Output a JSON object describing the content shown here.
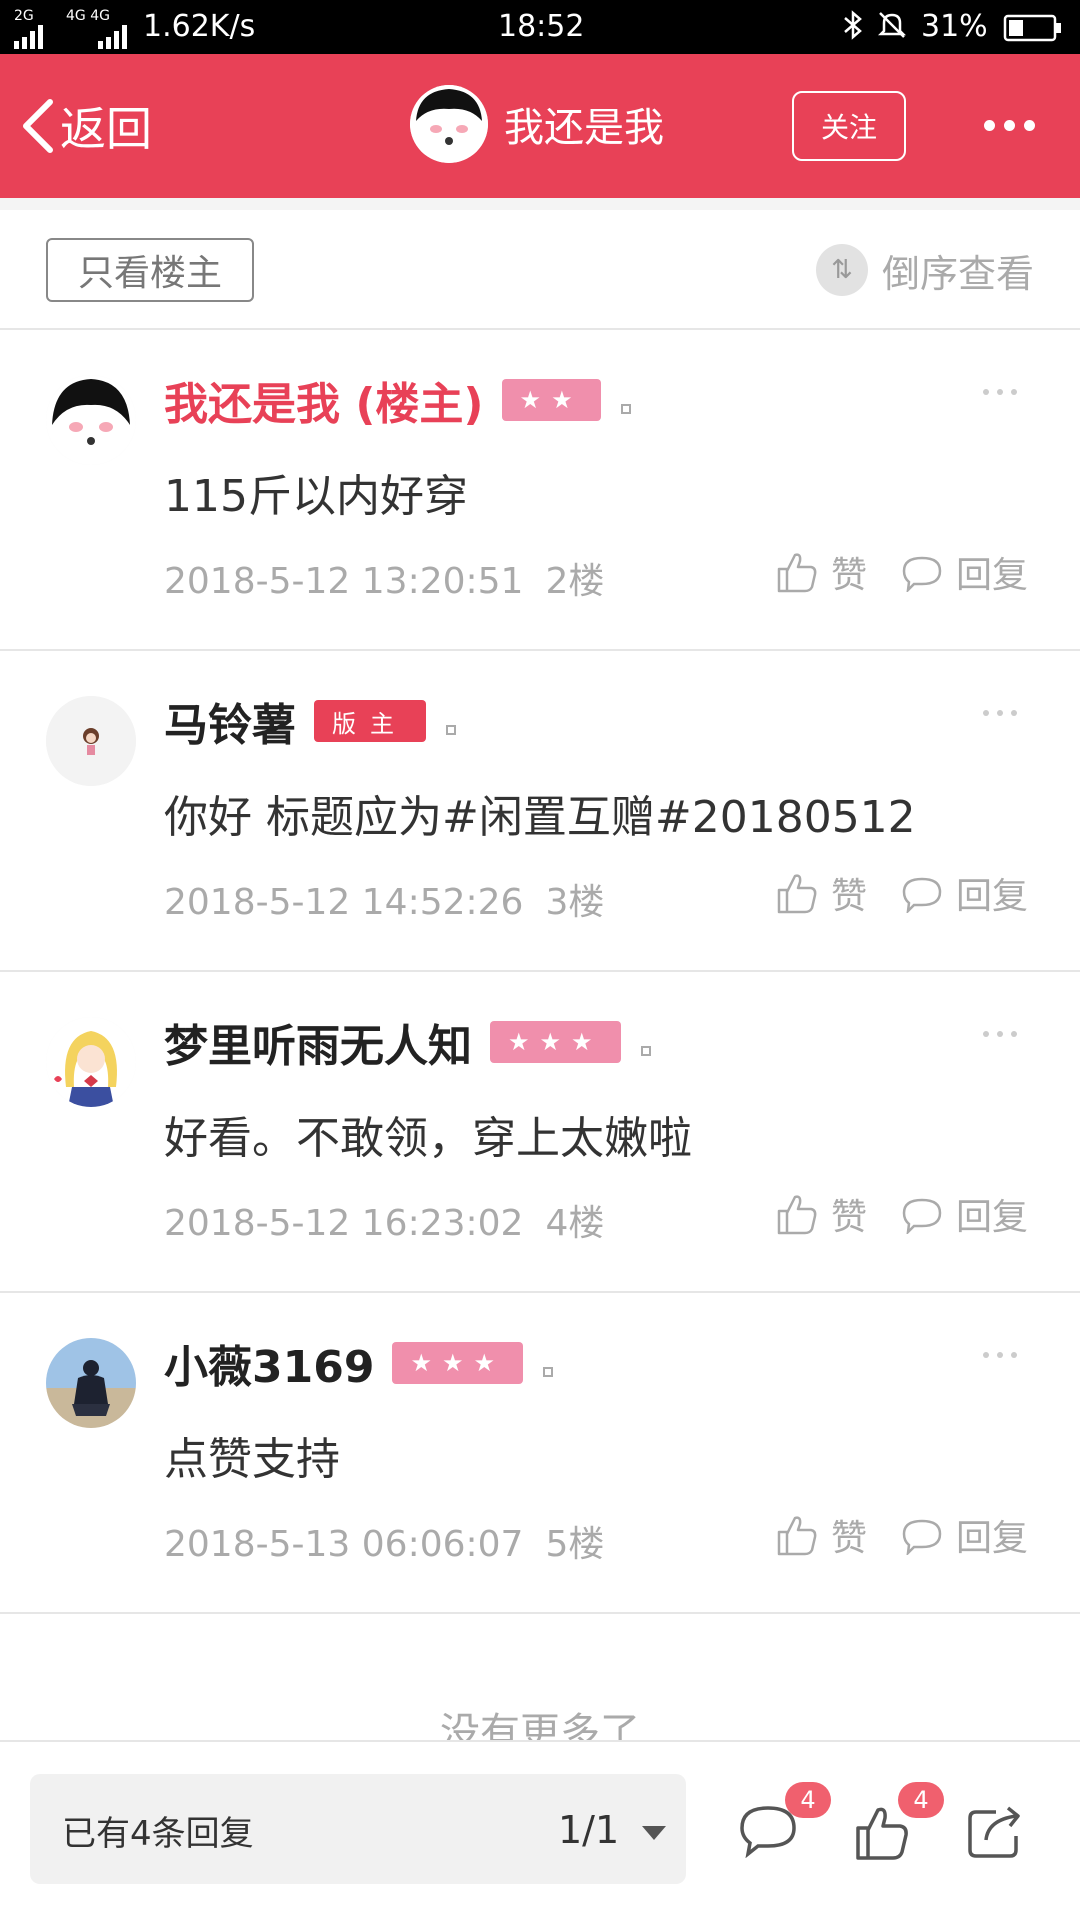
{
  "status_bar": {
    "network_left": "2G",
    "network_mid": "4G 4G",
    "speed": "1.62K/s",
    "time": "18:52",
    "battery": "31%"
  },
  "header": {
    "back_label": "返回",
    "title": "我还是我",
    "follow_label": "关注",
    "accent_color": "#e84157"
  },
  "filter": {
    "only_op_label": "只看楼主",
    "reverse_label": "倒序查看"
  },
  "posts": [
    {
      "name": "我还是我 (楼主)",
      "badge": "★★",
      "content": "115斤以内好穿",
      "time": "2018-5-12 13:20:51",
      "floor": "2楼",
      "like": "赞",
      "reply": "回复"
    },
    {
      "name": "马铃薯",
      "badge": "版主",
      "content": "你好 标题应为#闲置互赠#20180512",
      "time": "2018-5-12 14:52:26",
      "floor": "3楼",
      "like": "赞",
      "reply": "回复"
    },
    {
      "name": "梦里听雨无人知",
      "badge": "★★★",
      "content": "好看。不敢领，穿上太嫩啦",
      "time": "2018-5-12 16:23:02",
      "floor": "4楼",
      "like": "赞",
      "reply": "回复"
    },
    {
      "name": "小薇3169",
      "badge": "★★★",
      "content": "点赞支持",
      "time": "2018-5-13 06:06:07",
      "floor": "5楼",
      "like": "赞",
      "reply": "回复"
    }
  ],
  "no_more": "没有更多了",
  "bottom_bar": {
    "reply_count_label": "已有4条回复",
    "page": "1/1",
    "comment_count": "4",
    "like_count": "4"
  }
}
